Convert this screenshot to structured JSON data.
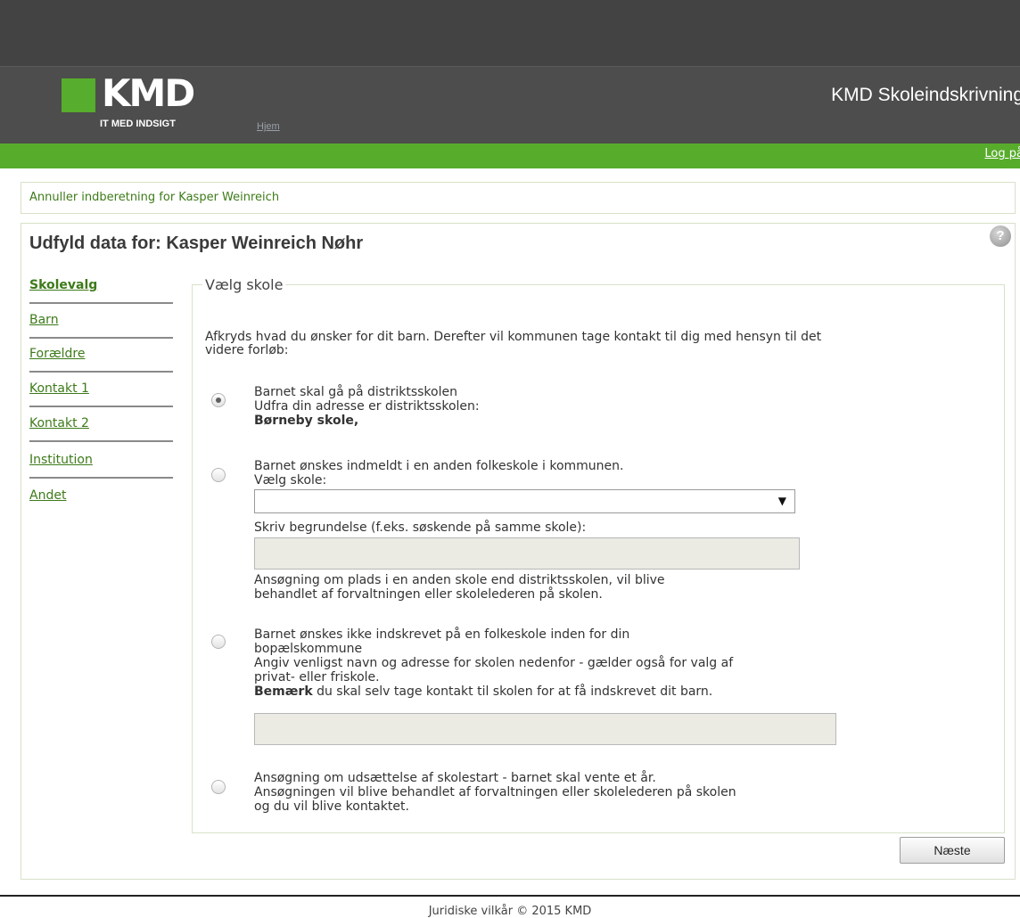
{
  "header": {
    "logo_text": "KMD",
    "logo_tagline": "IT MED INDSIGT",
    "home_link": "Hjem",
    "app_title": "KMD Skoleindskrivning",
    "login_link": "Log på"
  },
  "cancel_link": "Annuller indberetning for Kasper Weinreich",
  "page_title": "Udfyld data for: Kasper Weinreich Nøhr",
  "help_icon": "?",
  "sidebar": {
    "items": [
      {
        "label": "Skolevalg",
        "active": true
      },
      {
        "label": "Barn",
        "active": false
      },
      {
        "label": "Forældre",
        "active": false
      },
      {
        "label": "Kontakt 1",
        "active": false
      },
      {
        "label": "Kontakt 2",
        "active": false
      },
      {
        "label": "Institution",
        "active": false
      },
      {
        "label": "Andet",
        "active": false
      }
    ]
  },
  "form": {
    "legend": "Vælg skole",
    "intro_line1": "Afkryds hvad du ønsker for dit barn. Derefter vil kommunen tage kontakt til dig med hensyn til det",
    "intro_line2": "videre forløb:",
    "options": [
      {
        "selected": true,
        "line1": "Barnet skal gå på distriktsskolen",
        "line2": "Udfra din adresse er distriktsskolen:",
        "school": "Børneby skole,"
      },
      {
        "selected": false,
        "line1": "Barnet ønskes indmeldt i en anden folkeskole i kommunen.",
        "select_label": "Vælg skole:",
        "select_value": "",
        "reason_label": "Skriv begrundelse (f.eks. søskende på samme skole):",
        "reason_value": "",
        "note_line1": "Ansøgning om plads i en anden skole end distriktsskolen, vil blive",
        "note_line2": "behandlet af forvaltningen eller skolelederen på skolen."
      },
      {
        "selected": false,
        "line1": "Barnet ønskes ikke indskrevet på en folkeskole inden for din",
        "line2": "bopælskommune",
        "line3": "Angiv venligst navn og adresse for skolen nedenfor - gælder også for valg af",
        "line4": "privat- eller friskole.",
        "note_bold": "Bemærk",
        "note_rest": " du skal selv tage kontakt til skolen for at få indskrevet dit barn.",
        "school_value": ""
      },
      {
        "selected": false,
        "line1": "Ansøgning om udsættelse af skolestart - barnet skal vente et år.",
        "line2": "Ansøgningen vil blive behandlet af forvaltningen eller skolelederen på skolen",
        "line3": "og du vil blive kontaktet."
      }
    ]
  },
  "next_button": "Næste",
  "footer": "Juridiske vilkår © 2015 KMD"
}
